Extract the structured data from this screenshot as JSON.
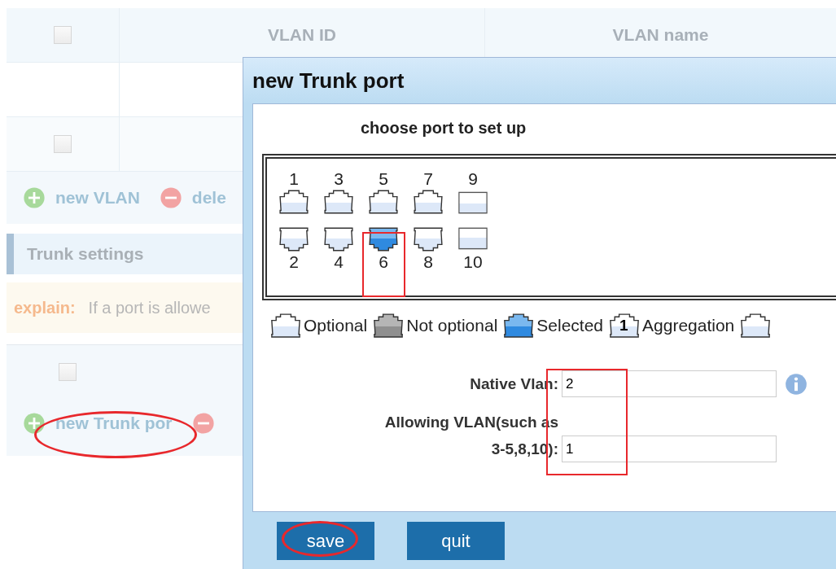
{
  "background": {
    "table": {
      "columns": [
        "VLAN ID",
        "VLAN name"
      ],
      "header_checked": false,
      "rows": [
        {
          "kind": "blank"
        },
        {
          "kind": "checkbox",
          "checked": false
        }
      ]
    },
    "toolbar": [
      {
        "kind": "add",
        "label": "new VLAN"
      },
      {
        "kind": "delete",
        "label": "dele"
      }
    ],
    "section_title": "Trunk settings",
    "explain": {
      "label": "explain:",
      "text": "If a port is allowe"
    },
    "trunk_table": {
      "checked": false
    },
    "trunk_toolbar": [
      {
        "kind": "add",
        "label": "new Trunk por"
      },
      {
        "kind": "delete"
      }
    ]
  },
  "dialog": {
    "title": "new Trunk port",
    "subtitle": "choose port to set up",
    "top_row": [
      {
        "number": "1",
        "kind": "rj45",
        "selected": false
      },
      {
        "number": "3",
        "kind": "rj45",
        "selected": false
      },
      {
        "number": "5",
        "kind": "rj45",
        "selected": false
      },
      {
        "number": "7",
        "kind": "rj45",
        "selected": false
      },
      {
        "number": "9",
        "kind": "fiber",
        "selected": false
      }
    ],
    "bottom_row": [
      {
        "number": "2",
        "kind": "rj45",
        "selected": false
      },
      {
        "number": "4",
        "kind": "rj45",
        "selected": false
      },
      {
        "number": "6",
        "kind": "rj45",
        "selected": true
      },
      {
        "number": "8",
        "kind": "rj45",
        "selected": false
      },
      {
        "number": "10",
        "kind": "fiber",
        "selected": false
      }
    ],
    "legend": [
      {
        "kind": "optional",
        "label": "Optional"
      },
      {
        "kind": "unavailable",
        "label": "Not optional"
      },
      {
        "kind": "selected",
        "label": "Selected"
      },
      {
        "kind": "aggregation",
        "mark": "1",
        "label": "Aggregation"
      },
      {
        "kind": "optional"
      }
    ],
    "fields": [
      {
        "label": [
          "Native Vlan:"
        ],
        "value": "2",
        "info": true
      },
      {
        "label": [
          "Allowing VLAN(such as",
          "3-5,8,10):"
        ],
        "value": "1"
      }
    ],
    "buttons": [
      "save",
      "quit"
    ]
  }
}
